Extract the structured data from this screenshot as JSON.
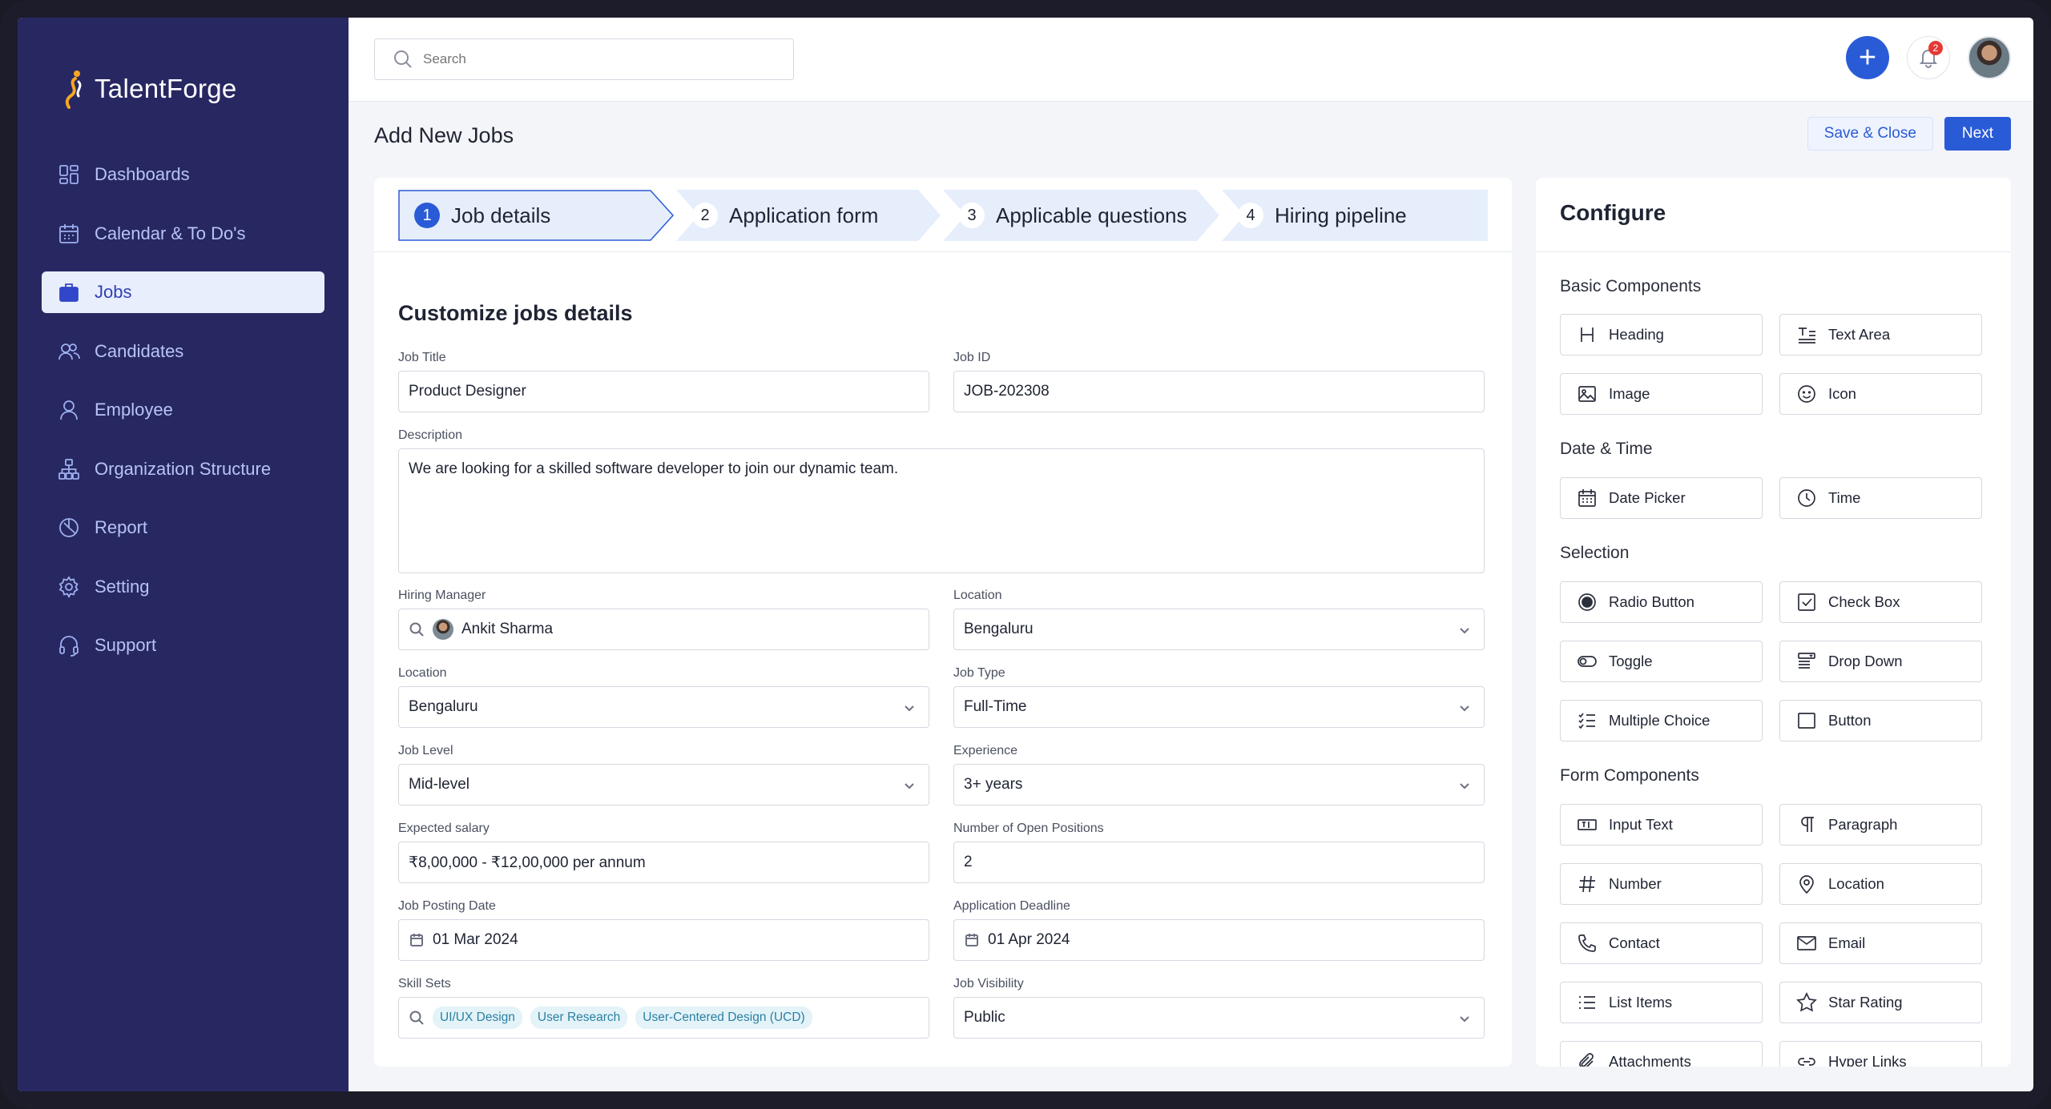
{
  "app": {
    "name": "TalentForge"
  },
  "sidebar": {
    "items": [
      {
        "label": "Dashboards",
        "icon": "dashboard-icon"
      },
      {
        "label": "Calendar & To Do's",
        "icon": "calendar-icon"
      },
      {
        "label": "Jobs",
        "icon": "briefcase-icon",
        "active": true
      },
      {
        "label": "Candidates",
        "icon": "users-icon"
      },
      {
        "label": "Employee",
        "icon": "user-icon"
      },
      {
        "label": "Organization Structure",
        "icon": "org-chart-icon"
      },
      {
        "label": "Report",
        "icon": "pie-chart-icon"
      },
      {
        "label": "Setting",
        "icon": "gear-icon"
      },
      {
        "label": "Support",
        "icon": "headset-icon"
      }
    ]
  },
  "topbar": {
    "search_placeholder": "Search",
    "notification_count": "2"
  },
  "page": {
    "title": "Add New Jobs",
    "save_close_label": "Save & Close",
    "next_label": "Next"
  },
  "steps": [
    {
      "num": "1",
      "label": "Job details",
      "active": true
    },
    {
      "num": "2",
      "label": "Application form"
    },
    {
      "num": "3",
      "label": "Applicable questions"
    },
    {
      "num": "4",
      "label": "Hiring pipeline"
    }
  ],
  "form": {
    "section_title": "Customize jobs details",
    "job_title": {
      "label": "Job Title",
      "value": "Product Designer"
    },
    "job_id": {
      "label": "Job ID",
      "value": "JOB-202308"
    },
    "description": {
      "label": "Description",
      "value": "We are looking for a skilled software developer to join our dynamic team."
    },
    "hiring_manager": {
      "label": "Hiring Manager",
      "value": "Ankit Sharma"
    },
    "location_right": {
      "label": "Location",
      "value": "Bengaluru"
    },
    "location_left": {
      "label": "Location",
      "value": "Bengaluru"
    },
    "job_type": {
      "label": "Job Type",
      "value": "Full-Time"
    },
    "job_level": {
      "label": "Job Level",
      "value": "Mid-level"
    },
    "experience": {
      "label": "Experience",
      "value": "3+ years"
    },
    "salary": {
      "label": "Expected salary",
      "value": "₹8,00,000 - ₹12,00,000 per annum"
    },
    "open_positions": {
      "label": "Number of Open Positions",
      "value": "2"
    },
    "posting_date": {
      "label": "Job Posting Date",
      "value": "01 Mar 2024"
    },
    "deadline": {
      "label": "Application Deadline",
      "value": "01 Apr 2024"
    },
    "skills": {
      "label": "Skill Sets",
      "chips": [
        "UI/UX Design",
        "User Research",
        "User-Centered Design (UCD)"
      ]
    },
    "visibility": {
      "label": "Job Visibility",
      "value": "Public"
    }
  },
  "configure": {
    "title": "Configure",
    "groups": [
      {
        "title": "Basic Components",
        "items": [
          {
            "label": "Heading",
            "icon": "heading-icon"
          },
          {
            "label": "Text Area",
            "icon": "text-area-icon"
          },
          {
            "label": "Image",
            "icon": "image-icon"
          },
          {
            "label": "Icon",
            "icon": "smiley-icon"
          }
        ]
      },
      {
        "title": "Date & Time",
        "items": [
          {
            "label": "Date Picker",
            "icon": "calendar-icon"
          },
          {
            "label": "Time",
            "icon": "clock-icon"
          }
        ]
      },
      {
        "title": "Selection",
        "items": [
          {
            "label": "Radio Button",
            "icon": "radio-icon"
          },
          {
            "label": "Check Box",
            "icon": "checkbox-icon"
          },
          {
            "label": "Toggle",
            "icon": "toggle-icon"
          },
          {
            "label": "Drop Down",
            "icon": "dropdown-icon"
          },
          {
            "label": "Multiple Choice",
            "icon": "checklist-icon"
          },
          {
            "label": "Button",
            "icon": "button-icon"
          }
        ]
      },
      {
        "title": "Form Components",
        "items": [
          {
            "label": "Input Text",
            "icon": "input-text-icon"
          },
          {
            "label": "Paragraph",
            "icon": "paragraph-icon"
          },
          {
            "label": "Number",
            "icon": "hash-icon"
          },
          {
            "label": "Location",
            "icon": "pin-icon"
          },
          {
            "label": "Contact",
            "icon": "phone-icon"
          },
          {
            "label": "Email",
            "icon": "mail-icon"
          },
          {
            "label": "List Items",
            "icon": "list-icon"
          },
          {
            "label": "Star Rating",
            "icon": "star-icon"
          },
          {
            "label": "Attachments",
            "icon": "paperclip-icon"
          },
          {
            "label": "Hyper Links",
            "icon": "link-icon"
          }
        ]
      }
    ]
  },
  "colors": {
    "sidebar_bg": "#272862",
    "primary": "#2a5bd7",
    "chip_bg": "#e3f3f8"
  }
}
